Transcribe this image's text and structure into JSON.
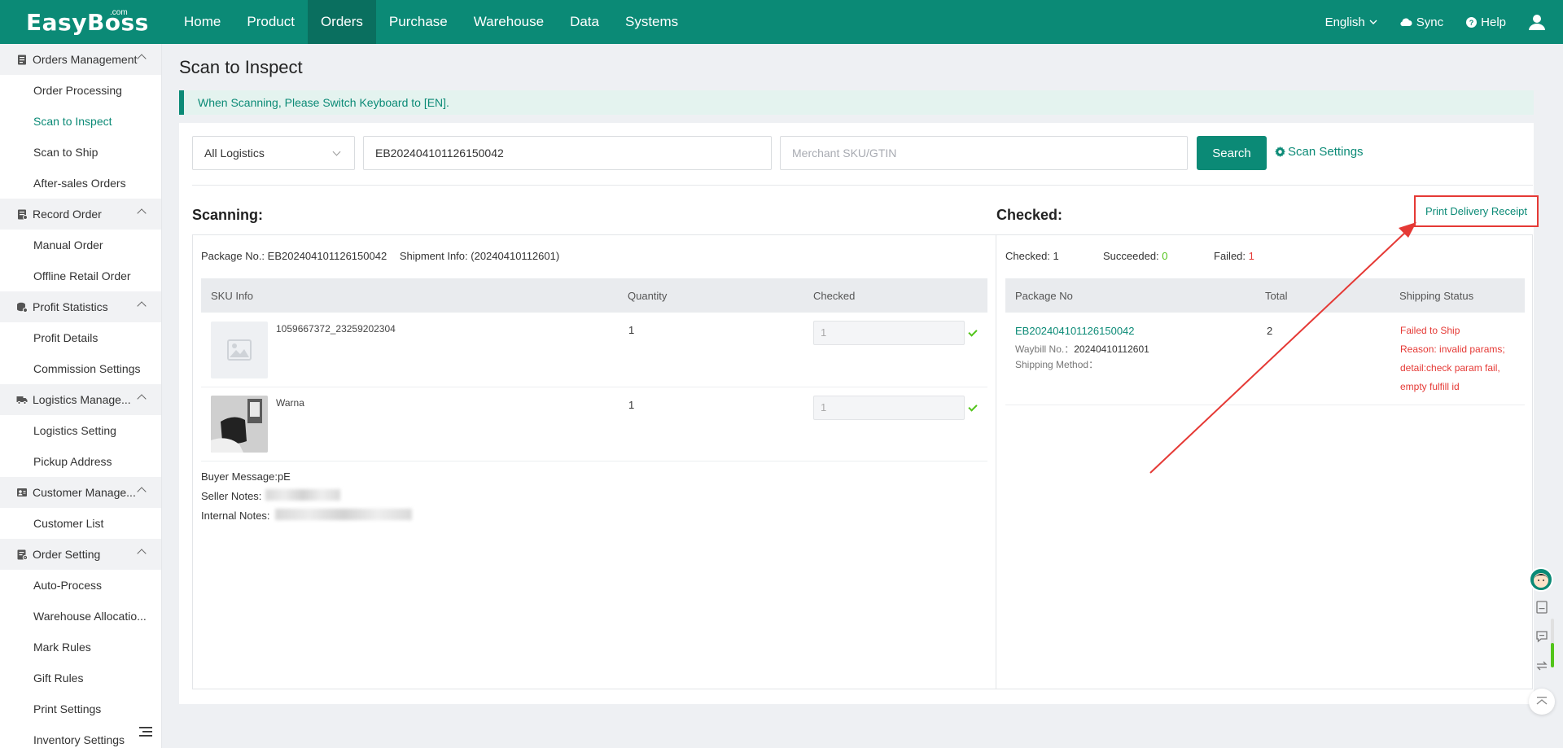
{
  "nav": {
    "logo": "EasyBoss",
    "logo_suffix": ".com",
    "menu": [
      {
        "label": "Home"
      },
      {
        "label": "Product"
      },
      {
        "label": "Orders",
        "active": true
      },
      {
        "label": "Purchase"
      },
      {
        "label": "Warehouse"
      },
      {
        "label": "Data"
      },
      {
        "label": "Systems"
      }
    ],
    "language": "English",
    "sync": "Sync",
    "help": "Help"
  },
  "sidebar": {
    "groups": [
      {
        "label": "Orders Management",
        "icon": "clipboard-icon",
        "items": [
          "Order Processing",
          "Scan to Inspect",
          "Scan to Ship",
          "After-sales Orders"
        ]
      },
      {
        "label": "Record Order",
        "icon": "record-icon",
        "items": [
          "Manual Order",
          "Offline Retail Order"
        ]
      },
      {
        "label": "Profit Statistics",
        "icon": "coins-icon",
        "items": [
          "Profit Details",
          "Commission Settings"
        ]
      },
      {
        "label": "Logistics Manage...",
        "icon": "truck-icon",
        "items": [
          "Logistics Setting",
          "Pickup Address"
        ]
      },
      {
        "label": "Customer Manage...",
        "icon": "customer-icon",
        "items": [
          "Customer List"
        ]
      },
      {
        "label": "Order Setting",
        "icon": "settings-doc-icon",
        "items": [
          "Auto-Process",
          "Warehouse Allocatio...",
          "Mark Rules",
          "Gift Rules",
          "Print Settings",
          "Inventory Settings"
        ]
      }
    ],
    "active_item": "Scan to Inspect"
  },
  "page": {
    "title": "Scan to Inspect",
    "notice": "When Scanning, Please Switch Keyboard to [EN]."
  },
  "filters": {
    "logistics_select": "All Logistics",
    "package_input": "EB202404101126150042",
    "sku_placeholder": "Merchant SKU/GTIN",
    "search_label": "Search",
    "scan_settings_label": "Scan Settings"
  },
  "scanning": {
    "title": "Scanning:",
    "package_label": "Package No.: ",
    "package_no": "EB202404101126150042",
    "shipment_label": "Shipment Info: ",
    "shipment_info": "(20240410112601)",
    "headers": {
      "sku": "SKU Info",
      "quantity": "Quantity",
      "checked": "Checked"
    },
    "rows": [
      {
        "sku": "1059667372_23259202304",
        "quantity": "1",
        "checked": "1"
      },
      {
        "sku": "Warna",
        "quantity": "1",
        "checked": "1"
      }
    ],
    "buyer_message_label": "Buyer Message:",
    "buyer_message": "pE",
    "seller_notes_label": "Seller Notes:",
    "internal_notes_label": "Internal Notes:"
  },
  "checked": {
    "title": "Checked:",
    "print_label": "Print Delivery Receipt",
    "checked_label": "Checked: ",
    "checked_count": "1",
    "succeeded_label": "Succeeded: ",
    "succeeded_count": "0",
    "failed_label": "Failed: ",
    "failed_count": "1",
    "headers": {
      "package": "Package No",
      "total": "Total",
      "status": "Shipping Status"
    },
    "row": {
      "package_no": "EB202404101126150042",
      "waybill_label": "Waybill No.：",
      "waybill_no": "20240410112601",
      "shipping_method_label": "Shipping Method：",
      "total": "2",
      "status_lines": [
        "Failed to Ship",
        "Reason: invalid params;",
        "detail:check param fail,",
        "empty fulfill id"
      ]
    }
  },
  "colors": {
    "brand": "#0b8a76",
    "error": "#e53935",
    "success": "#52c41a",
    "annotation": "#e53935"
  }
}
